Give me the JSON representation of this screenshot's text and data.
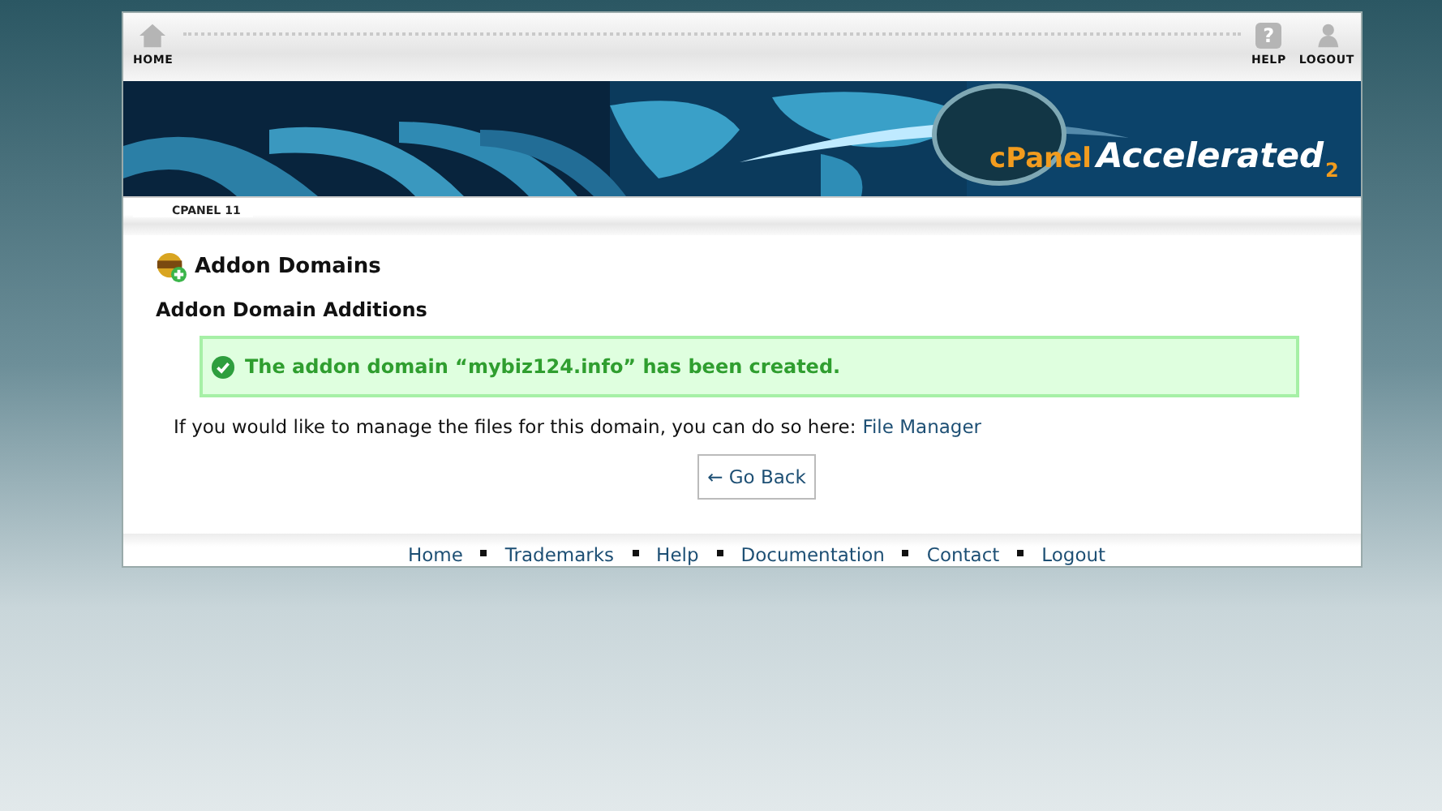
{
  "toolbar": {
    "left": [
      {
        "label": "HOME",
        "kind": "home"
      }
    ],
    "right": [
      {
        "label": "HELP",
        "kind": "help",
        "glyph": "?"
      },
      {
        "label": "LOGOUT",
        "kind": "logout"
      }
    ]
  },
  "banner": {
    "logo": "cPanel",
    "product": "Accelerated",
    "version": "2"
  },
  "breadcrumb": "CPANEL 11",
  "page_title": "Addon Domains",
  "section_title": "Addon Domain Additions",
  "success_message": "The addon domain “mybiz124.info” has been created.",
  "info_text": "If you would like to manage the files for this domain, you can do so here:",
  "info_link": "File Manager",
  "back_button": "← Go Back",
  "footer_links": [
    "Home",
    "Trademarks",
    "Help",
    "Documentation",
    "Contact",
    "Logout"
  ]
}
